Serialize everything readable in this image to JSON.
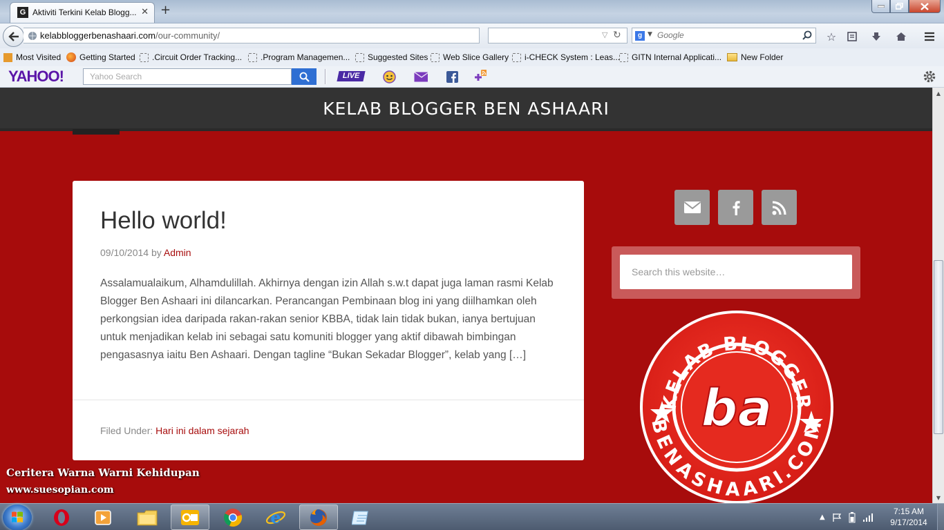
{
  "browser": {
    "tab_title": "Aktiviti Terkini Kelab Blogg...",
    "tab_favicon": "G",
    "new_tab_symbol": "+",
    "url_host": "kelabbloggerbenashaari.com",
    "url_path": "/our-community/",
    "search_engine_letter": "g",
    "search_placeholder": "Google"
  },
  "bookmarks": [
    {
      "label": "Most Visited",
      "icon": "most-visited-icon"
    },
    {
      "label": "Getting Started",
      "icon": "firefox-icon"
    },
    {
      "label": ".Circuit Order Tracking...",
      "icon": "page-icon"
    },
    {
      "label": ".Program Managemen...",
      "icon": "page-icon"
    },
    {
      "label": "Suggested Sites",
      "icon": "page-icon"
    },
    {
      "label": "Web Slice Gallery",
      "icon": "page-icon"
    },
    {
      "label": "i-CHECK System : Leas...",
      "icon": "page-icon"
    },
    {
      "label": "GITN Internal Applicati...",
      "icon": "page-icon"
    },
    {
      "label": "New Folder",
      "icon": "folder-icon"
    }
  ],
  "yahoo": {
    "logo": "YAHOO!",
    "search_placeholder": "Yahoo Search",
    "live_label": "LIVE"
  },
  "site": {
    "title": "KELAB BLOGGER BEN ASHAARI"
  },
  "post": {
    "title": "Hello world!",
    "date": "09/10/2014",
    "by": "by",
    "author": "Admin",
    "body": "Assalamualaikum, Alhamdulillah. Akhirnya dengan izin Allah s.w.t dapat juga laman rasmi Kelab Blogger Ben Ashaari ini dilancarkan. Perancangan Pembinaan blog ini yang diilhamkan oleh perkongsian idea daripada rakan-rakan senior KBBA, tidak lain tidak bukan, ianya bertujuan untuk menjadikan kelab ini sebagai satu komuniti blogger yang aktif dibawah bimbingan pengasasnya iaitu Ben Ashaari. Dengan tagline “Bukan Sekadar Blogger”, kelab yang […]",
    "filed_under": "Filed Under:",
    "category": "Hari ini dalam sejarah"
  },
  "sidebar": {
    "social_icons": [
      "email-icon",
      "facebook-icon",
      "rss-icon"
    ],
    "search_placeholder": "Search this website…",
    "badge_top_text": "KELAB BLOGGER",
    "badge_bottom_text": "BENASHAARI.COM",
    "badge_monogram": "ba"
  },
  "watermark": {
    "line1": "Ceritera Warna Warni Kehidupan",
    "line2": "www.suesopian.com"
  },
  "taskbar": {
    "apps": [
      "opera-icon",
      "media-player-icon",
      "file-explorer-icon",
      "outlook-icon",
      "chrome-icon",
      "internet-explorer-icon",
      "firefox-icon",
      "notepad-icon"
    ],
    "time": "7:15 AM",
    "date": "9/17/2014"
  },
  "colors": {
    "page_red": "#a70c0c",
    "header_dark": "#333333",
    "link_red": "#a70c0c",
    "yahoo_purple": "#5b16a8"
  }
}
